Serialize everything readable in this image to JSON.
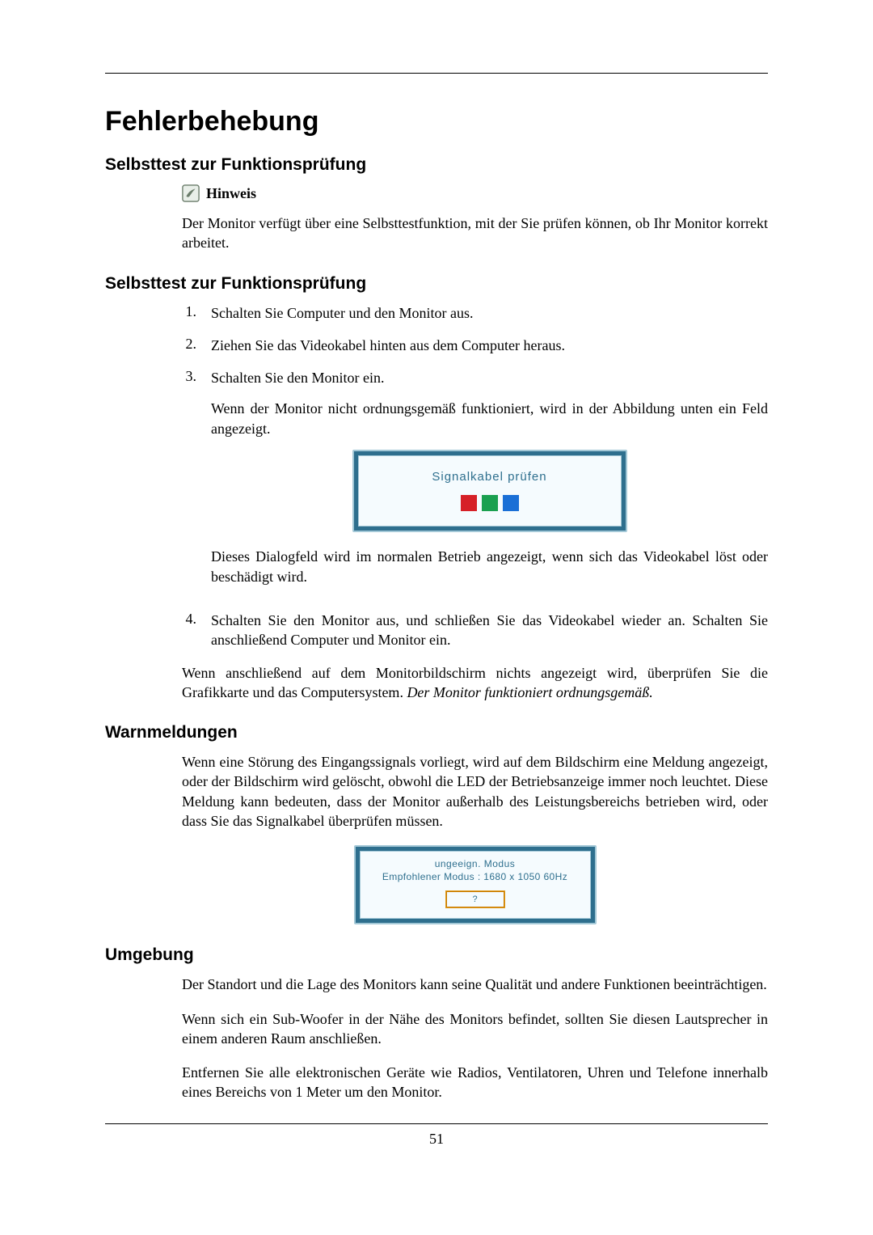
{
  "page_number": "51",
  "title": "Fehlerbehebung",
  "sec1": {
    "heading": "Selbsttest zur Funktionsprüfung",
    "note_label": "Hinweis",
    "note_body": "Der Monitor verfügt über eine Selbsttestfunktion, mit der Sie prüfen können, ob Ihr Monitor korrekt arbeitet."
  },
  "sec2": {
    "heading": "Selbsttest zur Funktionsprüfung",
    "steps": [
      {
        "n": "1.",
        "text": "Schalten Sie Computer und den Monitor aus."
      },
      {
        "n": "2.",
        "text": "Ziehen Sie das Videokabel hinten aus dem Computer heraus."
      },
      {
        "n": "3.",
        "text": "Schalten Sie den Monitor ein.",
        "after1": "Wenn der Monitor nicht ordnungsgemäß funktioniert, wird in der Abbildung unten ein Feld angezeigt.",
        "after2": "Dieses Dialogfeld wird im normalen Betrieb angezeigt, wenn sich das Videokabel löst oder beschädigt wird."
      },
      {
        "n": "4.",
        "text": "Schalten Sie den Monitor aus, und schließen Sie das Videokabel wieder an. Schalten Sie anschließend Computer und Monitor ein."
      }
    ],
    "figure1_title": "Signalkabel prüfen",
    "closing_plain": "Wenn anschließend auf dem Monitorbildschirm nichts angezeigt wird, überprüfen Sie die Grafikkarte und das Computersystem. ",
    "closing_italic": "Der Monitor funktioniert ordnungsgemäß."
  },
  "sec3": {
    "heading": "Warnmeldungen",
    "body": "Wenn eine Störung des Eingangssignals vorliegt, wird auf dem Bildschirm eine Meldung angezeigt, oder der Bildschirm wird gelöscht, obwohl die LED der Betriebsanzeige immer noch leuchtet. Diese Meldung kann bedeuten, dass der Monitor außerhalb des Leistungsbereichs betrieben wird, oder dass Sie das Signalkabel überprüfen müssen.",
    "fig2_line1": "ungeeign. Modus",
    "fig2_line2": "Empfohlener Modus : 1680 x 1050  60Hz",
    "fig2_btn": "?"
  },
  "sec4": {
    "heading": "Umgebung",
    "p1": "Der Standort und die Lage des Monitors kann seine Qualität und andere Funktionen beeinträchtigen.",
    "p2": "Wenn sich ein Sub-Woofer in der Nähe des Monitors befindet, sollten Sie diesen Lautsprecher in einem anderen Raum anschließen.",
    "p3": "Entfernen Sie alle elektronischen Geräte wie Radios, Ventilatoren, Uhren und Telefone innerhalb eines Bereichs von 1 Meter um den Monitor."
  }
}
